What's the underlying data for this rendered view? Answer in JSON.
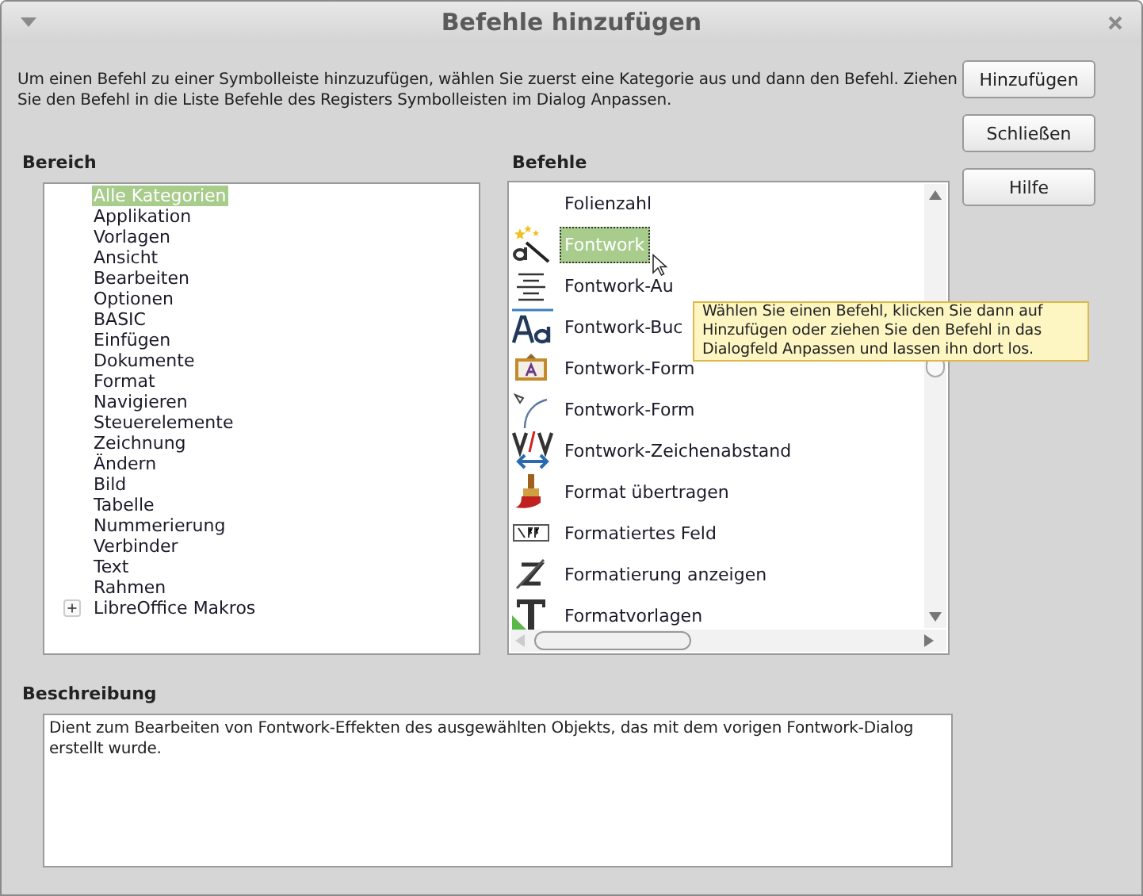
{
  "window": {
    "title": "Befehle hinzufügen"
  },
  "intro": "Um einen Befehl zu einer Symbolleiste hinzuzufügen, wählen Sie zuerst eine Kategorie aus und dann den Befehl. Ziehen Sie den Befehl in die Liste Befehle des Registers Symbolleisten im Dialog Anpassen.",
  "buttons": [
    "Hinzufügen",
    "Schließen",
    "Hilfe"
  ],
  "categories": {
    "heading": "Bereich",
    "items": [
      {
        "label": "Alle Kategorien",
        "selected": true
      },
      {
        "label": "Applikation",
        "selected": false
      },
      {
        "label": "Vorlagen",
        "selected": false
      },
      {
        "label": "Ansicht",
        "selected": false
      },
      {
        "label": "Bearbeiten",
        "selected": false
      },
      {
        "label": "Optionen",
        "selected": false
      },
      {
        "label": "BASIC",
        "selected": false
      },
      {
        "label": "Einfügen",
        "selected": false
      },
      {
        "label": "Dokumente",
        "selected": false
      },
      {
        "label": "Format",
        "selected": false
      },
      {
        "label": "Navigieren",
        "selected": false
      },
      {
        "label": "Steuerelemente",
        "selected": false
      },
      {
        "label": "Zeichnung",
        "selected": false
      },
      {
        "label": "Ändern",
        "selected": false
      },
      {
        "label": "Bild",
        "selected": false
      },
      {
        "label": "Tabelle",
        "selected": false
      },
      {
        "label": "Nummerierung",
        "selected": false
      },
      {
        "label": "Verbinder",
        "selected": false
      },
      {
        "label": "Text",
        "selected": false
      },
      {
        "label": "Rahmen",
        "selected": false
      }
    ],
    "macros_node": {
      "label": "LibreOffice Makros",
      "expanded": false,
      "selected": false
    }
  },
  "commands": {
    "heading": "Befehle",
    "items": [
      {
        "label": "Folienzahl",
        "selected": false
      },
      {
        "label": "Fontwork",
        "selected": true
      },
      {
        "label": "Fontwork-Au",
        "selected": false
      },
      {
        "label": "Fontwork-Buc",
        "selected": false
      },
      {
        "label": "Fontwork-Form",
        "selected": false
      },
      {
        "label": "Fontwork-Form",
        "selected": false
      },
      {
        "label": "Fontwork-Zeichenabstand",
        "selected": false
      },
      {
        "label": "Format übertragen",
        "selected": false
      },
      {
        "label": "Formatiertes Feld",
        "selected": false
      },
      {
        "label": "Formatierung anzeigen",
        "selected": false
      },
      {
        "label": "Formatvorlagen",
        "selected": false
      }
    ]
  },
  "tooltip": "Wählen Sie einen Befehl, klicken Sie dann auf Hinzufügen oder ziehen Sie den Befehl in das Dialogfeld Anpassen und lassen ihn dort los.",
  "description": {
    "heading": "Beschreibung",
    "text": "Dient zum Bearbeiten von Fontwork-Effekten des ausgewählten Objekts, das mit dem vorigen Fontwork-Dialog erstellt wurde."
  }
}
